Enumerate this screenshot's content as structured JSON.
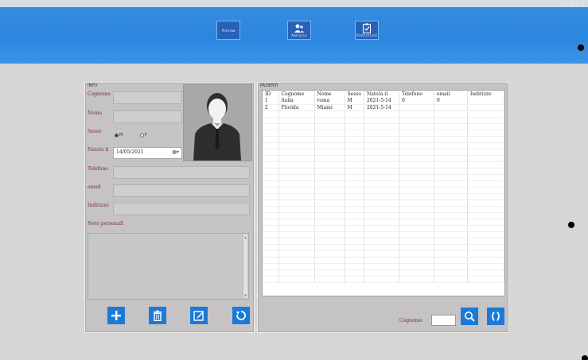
{
  "window_controls": "‹ □ –",
  "nav": [
    {
      "label": "Preview",
      "icon": "preview-icon"
    },
    {
      "label": "Analysis",
      "icon": "users-icon"
    },
    {
      "label": "Statistical",
      "icon": "clipboard-icon"
    }
  ],
  "info_panel": {
    "title": "INFO",
    "cognome_label": "Cognome",
    "nome_label": "Nome",
    "sesso_label": "Sesso",
    "sesso_options": [
      "M",
      "F"
    ],
    "sesso_selected": "M",
    "nato_label": "Nato/a il",
    "nato_value": "14/05/2021",
    "telefono_label": "Telefono",
    "email_label": "email",
    "indirizzo_label": "Indirizzo",
    "note_label": "Note personali",
    "photo_icon": "person-avatar-icon"
  },
  "actions": [
    {
      "name": "add-button",
      "icon": "plus-icon"
    },
    {
      "name": "delete-button",
      "icon": "trash-icon"
    },
    {
      "name": "edit-button",
      "icon": "edit-icon"
    },
    {
      "name": "refresh-button",
      "icon": "refresh-icon"
    }
  ],
  "patient_panel": {
    "title": "PAZIENTI",
    "columns": [
      "ID",
      "Cognome",
      "Nome",
      "Sesso",
      "Nato/a il",
      "Telefono",
      "email",
      "Indirizzo"
    ],
    "rows": [
      [
        "1",
        "italia",
        "roma",
        "M",
        "2021-5-14",
        "0",
        "0",
        ""
      ],
      [
        "2",
        "Florida",
        "Miami",
        "M",
        "2021-5-14",
        "",
        "",
        ""
      ]
    ],
    "search_label": "Cognome",
    "search_value": ""
  },
  "colors": {
    "accent": "#1b7ad8",
    "header": "#2a86de",
    "label": "#7b2a46"
  }
}
